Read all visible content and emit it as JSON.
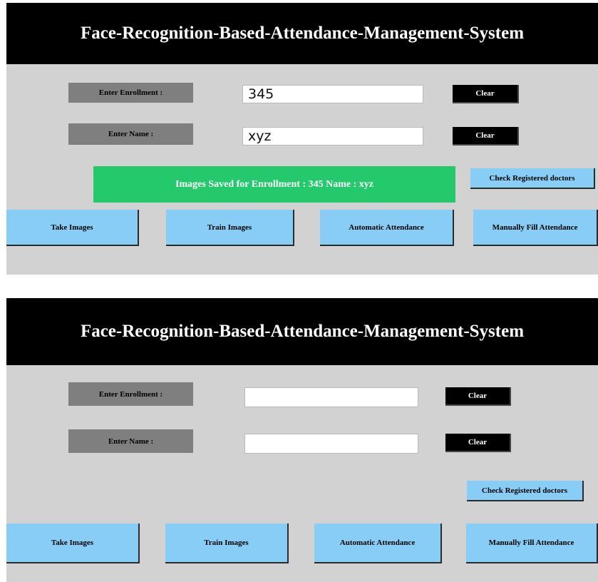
{
  "screens": [
    {
      "title": "Face-Recognition-Based-Attendance-Management-System",
      "enrollment_label": "Enter Enrollment :",
      "enrollment_value": "345",
      "name_label": "Enter Name :",
      "name_value": "xyz",
      "clear_label": "Clear",
      "notification": "Images Saved for Enrollment : 345 Name : xyz",
      "check_button": "Check Registered doctors",
      "buttons": [
        "Take Images",
        "Train Images",
        "Automatic Attendance",
        "Manually Fill Attendance"
      ]
    },
    {
      "title": "Face-Recognition-Based-Attendance-Management-System",
      "enrollment_label": "Enter Enrollment :",
      "enrollment_value": "",
      "name_label": "Enter Name :",
      "name_value": "",
      "clear_label": "Clear",
      "check_button": "Check Registered doctors",
      "buttons": [
        "Take Images",
        "Train Images",
        "Automatic Attendance",
        "Manually Fill Attendance"
      ]
    }
  ],
  "colors": {
    "title_bar": "#000000",
    "panel": "#d2d2d2",
    "label_bg": "#7f7f7f",
    "notification": "#23c96a",
    "button": "#87cdf5"
  }
}
